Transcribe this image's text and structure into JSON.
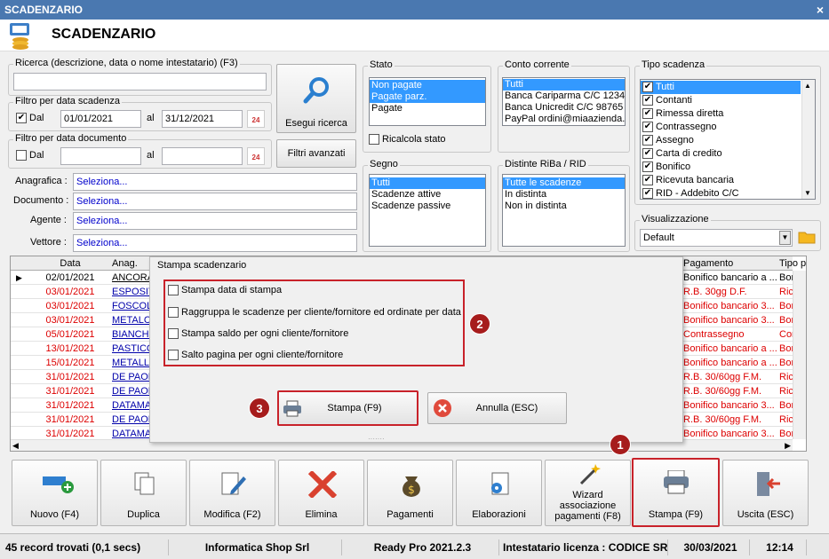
{
  "window": {
    "title": "SCADENZARIO",
    "header_title": "SCADENZARIO",
    "close": "×"
  },
  "search": {
    "label": "Ricerca (descrizione, data o nome intestatario) (F3)",
    "value": "",
    "button": "Esegui ricerca"
  },
  "filter_scadenza": {
    "label": "Filtro per data scadenza",
    "check_label": "Dal",
    "checked": true,
    "from": "01/01/2021",
    "to_label": "al",
    "to": "31/12/2021",
    "cal_label": "24"
  },
  "filter_documento": {
    "label": "Filtro per data documento",
    "check_label": "Dal",
    "checked": false,
    "from": "",
    "to_label": "al",
    "to": "",
    "cal_label": "24"
  },
  "advanced_button": "Filtri avanzati",
  "anagrafica": {
    "label": "Anagrafica :",
    "value": "Seleziona..."
  },
  "documento": {
    "label": "Documento :",
    "value": "Seleziona..."
  },
  "agente": {
    "label": "Agente :",
    "value": "Seleziona..."
  },
  "vettore": {
    "label": "Vettore :",
    "value": "Seleziona..."
  },
  "stato": {
    "label": "Stato",
    "items": [
      "Non pagate",
      "Pagate parz.",
      "Pagate"
    ],
    "recalc_label": "Ricalcola stato"
  },
  "conto": {
    "label": "Conto corrente",
    "items": [
      "Tutti",
      "Banca Cariparma C/C 12345",
      "Banca Unicredit C/C 98765",
      "PayPal ordini@miaazienda.c"
    ]
  },
  "tipo": {
    "label": "Tipo scadenza",
    "items": [
      "Tutti",
      "Contanti",
      "Rimessa diretta",
      "Contrassegno",
      "Assegno",
      "Carta di credito",
      "Bonifico",
      "Ricevuta bancaria",
      "RID - Addebito C/C"
    ]
  },
  "segno": {
    "label": "Segno",
    "items": [
      "Tutti",
      "Scadenze attive",
      "Scadenze passive"
    ]
  },
  "distinte": {
    "label": "Distinte RiBa / RID",
    "items": [
      "Tutte le scadenze",
      "In distinta",
      "Non in distinta"
    ]
  },
  "visualizzazione": {
    "label": "Visualizzazione",
    "value": "Default"
  },
  "grid": {
    "headers": [
      "Data",
      "Anag.",
      "Pagamento",
      "Tipo p"
    ],
    "rows": [
      {
        "date": "02/01/2021",
        "anag": "ANCORA",
        "pag": "Bonifico bancario a ...",
        "tipo": "Bonific",
        "red": false
      },
      {
        "date": "03/01/2021",
        "anag": "ESPOSIT",
        "pag": "R.B. 30gg D.F.",
        "tipo": "Ricevu",
        "red": true
      },
      {
        "date": "03/01/2021",
        "anag": "FOSCOL",
        "pag": "Bonifico bancario 3...",
        "tipo": "Bonific",
        "red": true
      },
      {
        "date": "03/01/2021",
        "anag": "METALCA",
        "pag": "Bonifico bancario 3...",
        "tipo": "Bonific",
        "red": true
      },
      {
        "date": "05/01/2021",
        "anag": "BIANCHI",
        "pag": "Contrassegno",
        "tipo": "Contra",
        "red": true
      },
      {
        "date": "13/01/2021",
        "anag": "PASTICC",
        "pag": "Bonifico bancario a ...",
        "tipo": "Bonific",
        "red": true
      },
      {
        "date": "15/01/2021",
        "anag": "METALLI",
        "pag": "Bonifico bancario a ...",
        "tipo": "Bonific",
        "red": true
      },
      {
        "date": "31/01/2021",
        "anag": "DE PAOL",
        "pag": "R.B. 30/60gg F.M.",
        "tipo": "Ricevu",
        "red": true
      },
      {
        "date": "31/01/2021",
        "anag": "DE PAOL",
        "pag": "R.B. 30/60gg F.M.",
        "tipo": "Ricevu",
        "red": true
      },
      {
        "date": "31/01/2021",
        "anag": "DATAMA",
        "pag": "Bonifico bancario 3...",
        "tipo": "Bonific",
        "red": true
      },
      {
        "date": "31/01/2021",
        "anag": "DE PAOL",
        "pag": "R.B. 30/60gg F.M.",
        "tipo": "Ricevu",
        "red": true
      },
      {
        "date": "31/01/2021",
        "anag": "DATAMA",
        "pag": "Bonifico bancario 3...",
        "tipo": "Bonific",
        "red": true
      }
    ]
  },
  "modal": {
    "title": "Stampa scadenzario",
    "options": [
      "Stampa data di stampa",
      "Raggruppa le scadenze per cliente/fornitore ed ordinate per data",
      "Stampa saldo per ogni cliente/fornitore",
      "Salto pagina per ogni cliente/fornitore"
    ],
    "print_button": "Stampa (F9)",
    "cancel_button": "Annulla (ESC)"
  },
  "badges": [
    "1",
    "2",
    "3"
  ],
  "toolbar": [
    {
      "label": "Nuovo (F4)",
      "icon": "add-card-icon"
    },
    {
      "label": "Duplica",
      "icon": "copy-icon"
    },
    {
      "label": "Modifica (F2)",
      "icon": "edit-icon"
    },
    {
      "label": "Elimina",
      "icon": "delete-icon"
    },
    {
      "label": "Pagamenti",
      "icon": "money-bag-icon"
    },
    {
      "label": "Elaborazioni",
      "icon": "gear-document-icon"
    },
    {
      "label": "Wizard associazione pagamenti (F8)",
      "icon": "wizard-icon"
    },
    {
      "label": "Stampa (F9)",
      "icon": "printer-icon"
    },
    {
      "label": "Uscita (ESC)",
      "icon": "exit-icon"
    }
  ],
  "status": {
    "records": "45 record trovati (0,1 secs)",
    "company": "Informatica Shop Srl",
    "version": "Ready Pro 2021.2.3",
    "license": "Intestatario licenza : CODICE SR",
    "date": "30/03/2021",
    "time": "12:14"
  },
  "colors": {
    "title_bar": "#4a78b0",
    "selection": "#3399ff",
    "highlight_red": "#c8222a",
    "overdue_text": "#dd0000"
  }
}
